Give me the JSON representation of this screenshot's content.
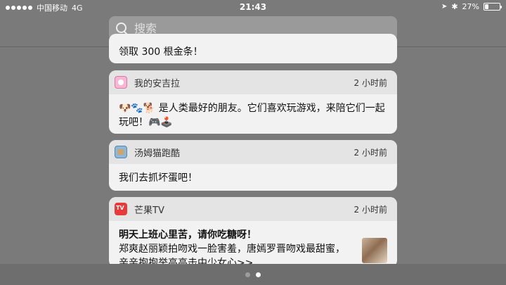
{
  "status": {
    "carrier": "中国移动",
    "network": "4G",
    "time": "21:43",
    "battery_percent": "27%",
    "battery_level": 0.27
  },
  "search": {
    "placeholder": "搜索"
  },
  "partial_card": {
    "body": "领取 300 根金条！"
  },
  "notifications": [
    {
      "app": "我的安吉拉",
      "time": "2 小时前",
      "body": "🐶🐾🐕 是人类最好的朋友。它们喜欢玩游戏，来陪它们一起玩吧！🎮🕹️"
    },
    {
      "app": "汤姆猫跑酷",
      "time": "2 小时前",
      "body": "我们去抓坏蛋吧！"
    },
    {
      "app": "芒果TV",
      "time": "2 小时前",
      "title": "明天上班心里苦，请你吃糖呀！",
      "body": "郑爽赵丽颖拍吻戏一脸害羞，唐嫣罗晋吻戏最甜蜜，亲亲抱抱举高高击中少女心>>"
    }
  ],
  "pager": {
    "page_count": 2,
    "current_page": 2
  }
}
